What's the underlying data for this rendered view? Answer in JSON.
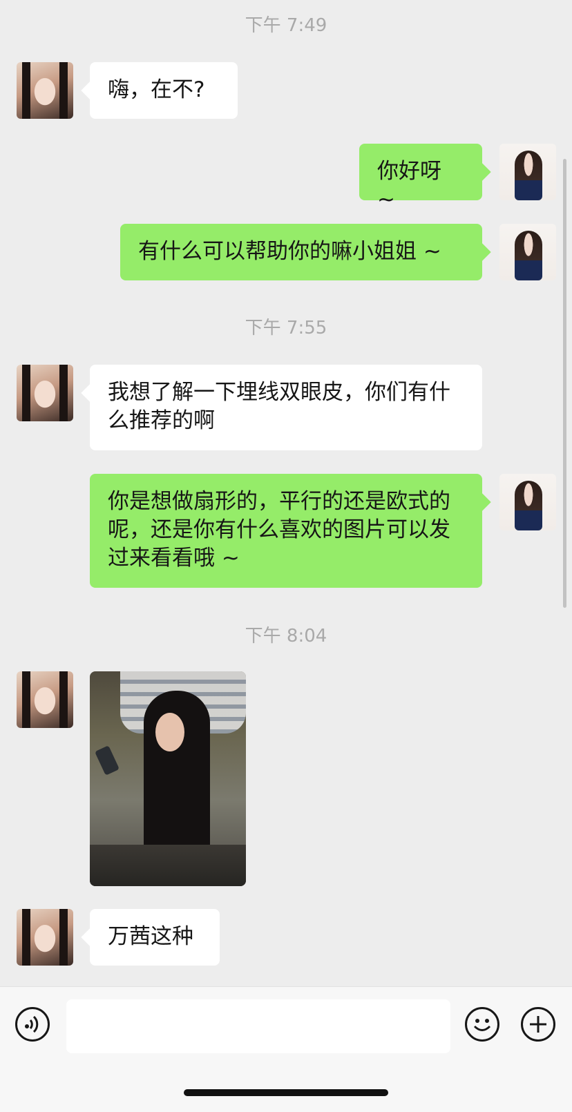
{
  "messages": {
    "time1": "下午 7:49",
    "m1": "嗨，在不?",
    "m2": "你好呀 ~",
    "m3": "有什么可以帮助你的嘛小姐姐 ~",
    "time2": "下午 7:55",
    "m4": "我想了解一下埋线双眼皮，你们有什么推荐的啊",
    "m5": "你是想做扇形的，平行的还是欧式的呢，还是你有什么喜欢的图片可以发过来看看哦 ~",
    "time3": "下午 8:04",
    "m7": "万茜这种"
  },
  "colors": {
    "background": "#ededed",
    "incoming_bubble": "#ffffff",
    "outgoing_bubble": "#95ec69",
    "timestamp": "#a9a9a9"
  },
  "icons": {
    "voice": "voice-icon",
    "emoji": "emoji-icon",
    "plus": "plus-icon"
  }
}
